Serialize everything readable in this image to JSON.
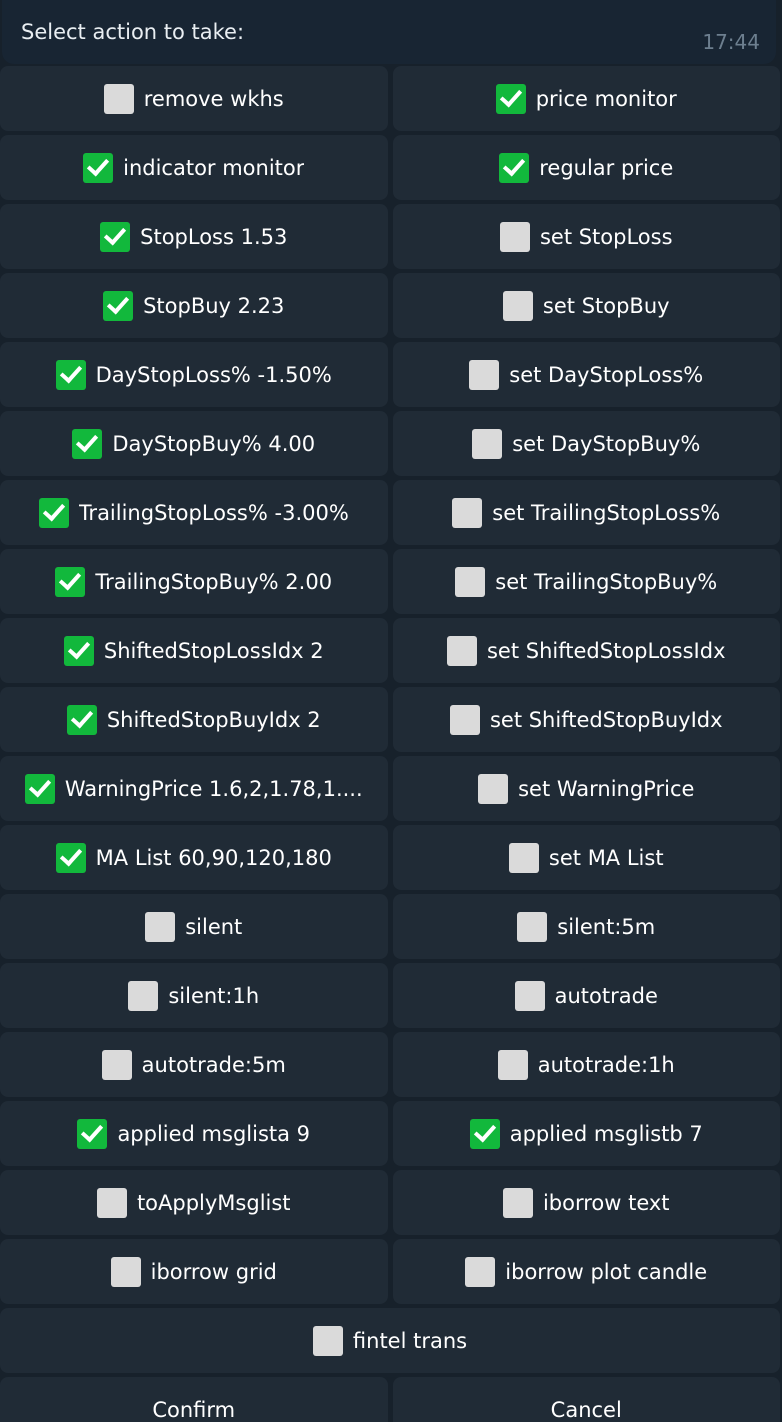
{
  "message": {
    "text": "Select action to take:",
    "time": "17:44"
  },
  "keyboard": {
    "rows": [
      [
        {
          "label": "remove wkhs",
          "checked": false
        },
        {
          "label": "price monitor",
          "checked": true
        }
      ],
      [
        {
          "label": "indicator monitor",
          "checked": true
        },
        {
          "label": "regular price",
          "checked": true
        }
      ],
      [
        {
          "label": "StopLoss 1.53",
          "checked": true
        },
        {
          "label": "set StopLoss",
          "checked": false
        }
      ],
      [
        {
          "label": "StopBuy 2.23",
          "checked": true
        },
        {
          "label": "set StopBuy",
          "checked": false
        }
      ],
      [
        {
          "label": "DayStopLoss% -1.50%",
          "checked": true
        },
        {
          "label": "set DayStopLoss%",
          "checked": false
        }
      ],
      [
        {
          "label": "DayStopBuy% 4.00",
          "checked": true
        },
        {
          "label": "set DayStopBuy%",
          "checked": false
        }
      ],
      [
        {
          "label": "TrailingStopLoss% -3.00%",
          "checked": true
        },
        {
          "label": "set TrailingStopLoss%",
          "checked": false
        }
      ],
      [
        {
          "label": "TrailingStopBuy% 2.00",
          "checked": true
        },
        {
          "label": "set TrailingStopBuy%",
          "checked": false
        }
      ],
      [
        {
          "label": "ShiftedStopLossIdx 2",
          "checked": true
        },
        {
          "label": "set ShiftedStopLossIdx",
          "checked": false
        }
      ],
      [
        {
          "label": "ShiftedStopBuyIdx 2",
          "checked": true
        },
        {
          "label": "set ShiftedStopBuyIdx",
          "checked": false
        }
      ],
      [
        {
          "label": "WarningPrice 1.6,2,1.78,1....",
          "checked": true
        },
        {
          "label": "set WarningPrice",
          "checked": false
        }
      ],
      [
        {
          "label": "MA List 60,90,120,180",
          "checked": true
        },
        {
          "label": "set MA List",
          "checked": false
        }
      ],
      [
        {
          "label": "silent",
          "checked": false
        },
        {
          "label": "silent:5m",
          "checked": false
        }
      ],
      [
        {
          "label": "silent:1h",
          "checked": false
        },
        {
          "label": "autotrade",
          "checked": false
        }
      ],
      [
        {
          "label": "autotrade:5m",
          "checked": false
        },
        {
          "label": "autotrade:1h",
          "checked": false
        }
      ],
      [
        {
          "label": "applied msglista 9",
          "checked": true
        },
        {
          "label": "applied msglistb 7",
          "checked": true
        }
      ],
      [
        {
          "label": "toApplyMsglist",
          "checked": false
        },
        {
          "label": "iborrow text",
          "checked": false
        }
      ],
      [
        {
          "label": "iborrow grid",
          "checked": false
        },
        {
          "label": "iborrow plot candle",
          "checked": false
        }
      ],
      [
        {
          "label": "fintel trans",
          "checked": false
        }
      ],
      [
        {
          "label": "Confirm"
        },
        {
          "label": "Cancel"
        }
      ]
    ]
  },
  "icons": {
    "checked": "check-mark-button-icon",
    "unchecked": "white-square-icon"
  },
  "colors": {
    "background": "#17212b",
    "button": "#202b36",
    "check_green": "#12b83c",
    "square_gray": "#dadada"
  }
}
